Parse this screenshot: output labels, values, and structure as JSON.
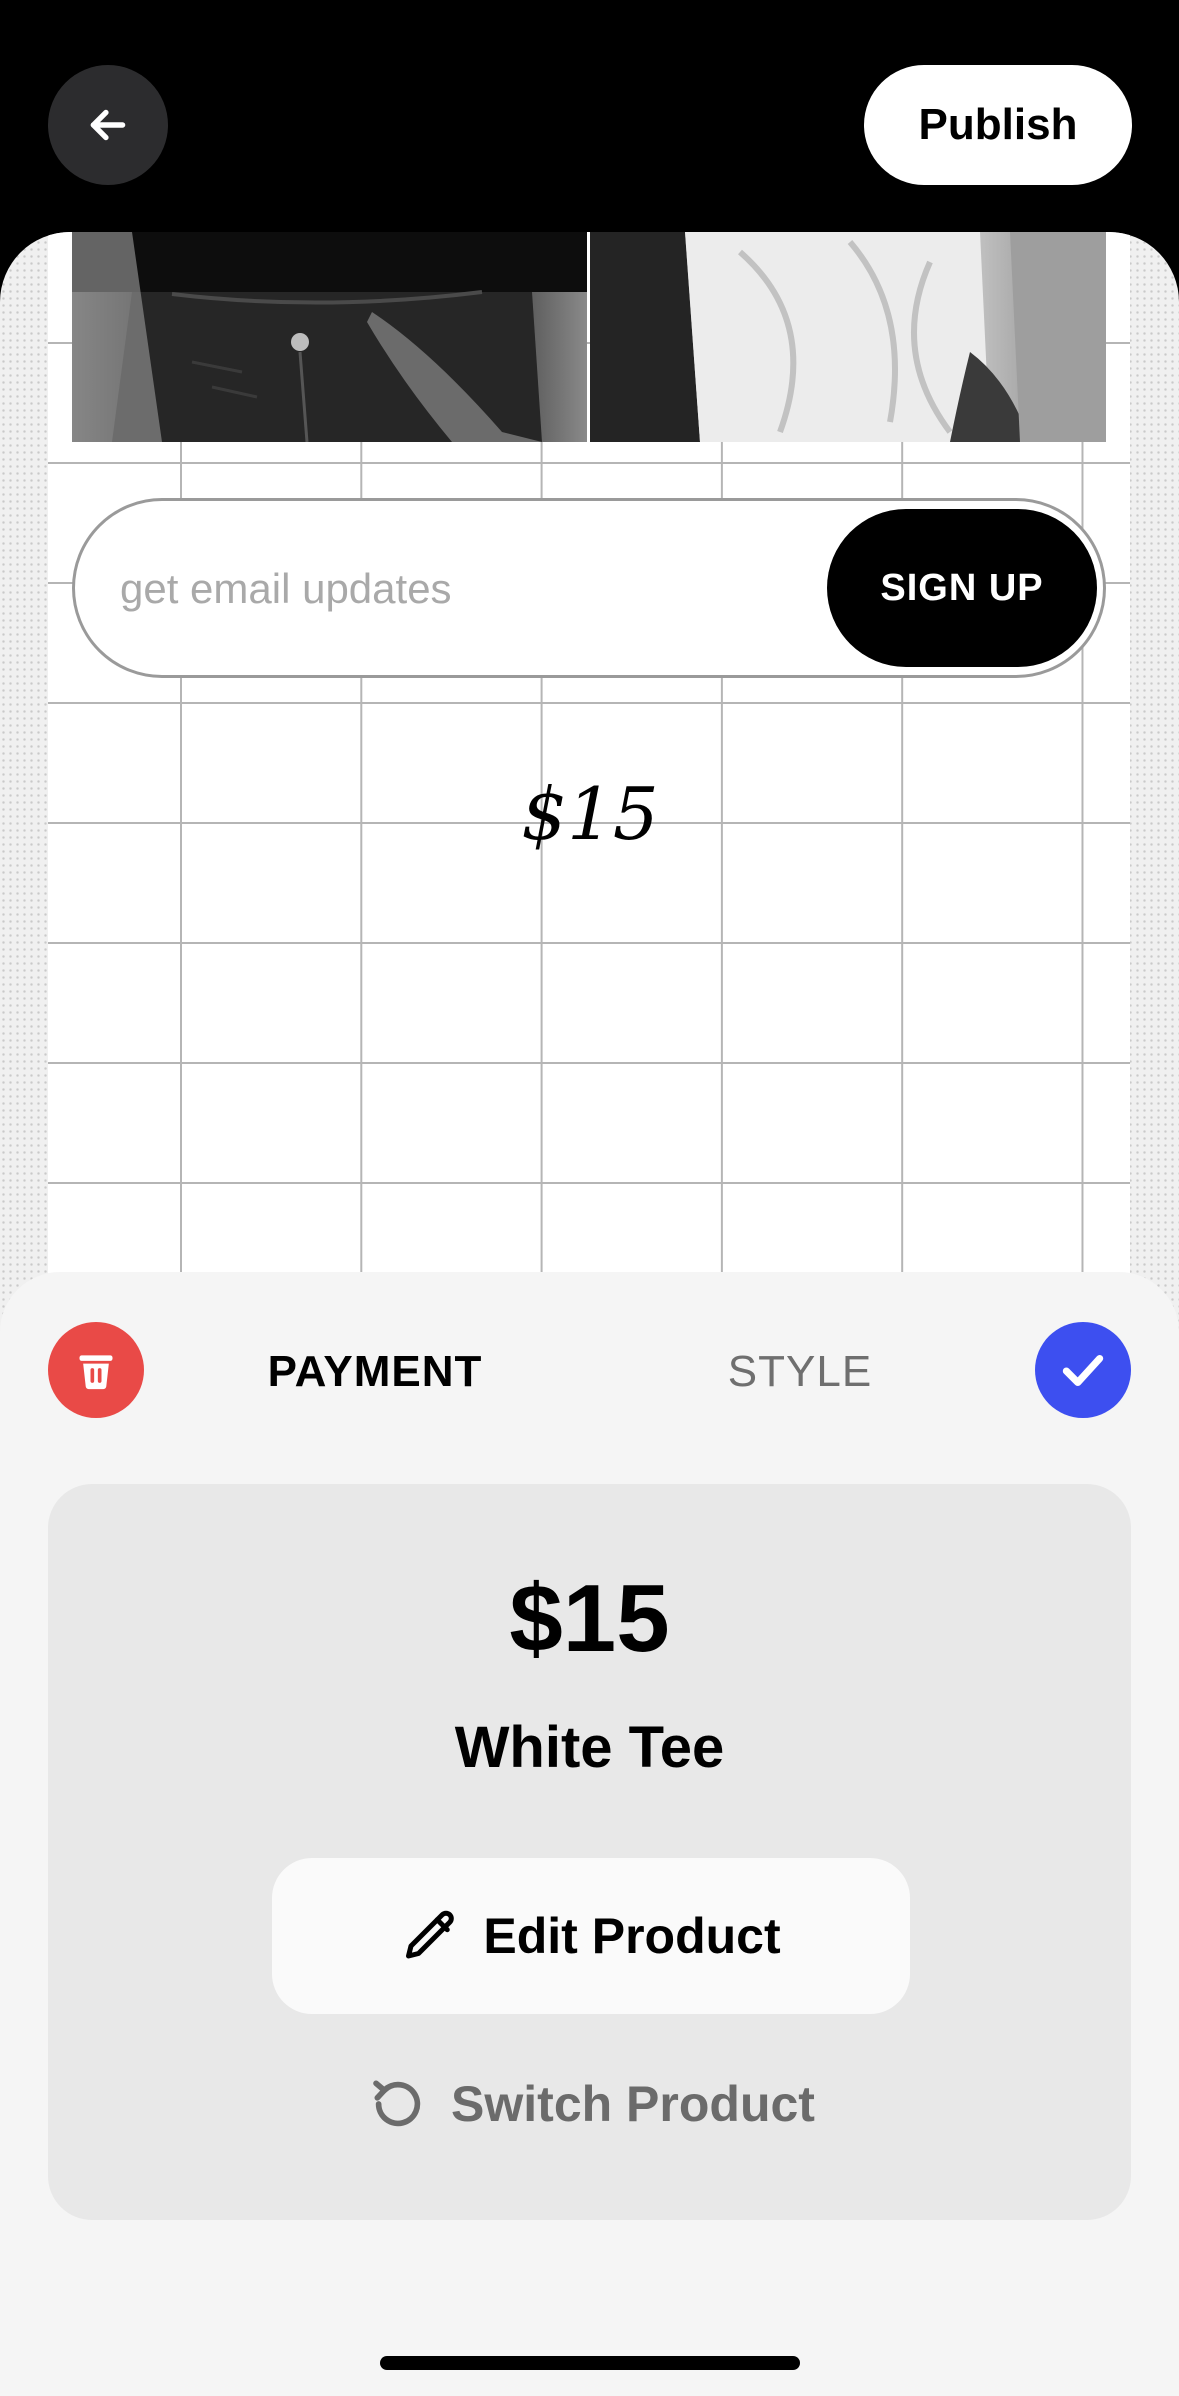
{
  "header": {
    "back_icon": "arrow-left-icon",
    "publish_label": "Publish"
  },
  "canvas": {
    "email_placeholder": "get email updates",
    "signup_label": "SIGN UP",
    "price_text": "$15"
  },
  "sheet": {
    "delete_icon": "trash-icon",
    "confirm_icon": "checkmark-icon",
    "tabs": [
      {
        "label": "PAYMENT",
        "active": true
      },
      {
        "label": "STYLE",
        "active": false
      }
    ],
    "product": {
      "price": "$15",
      "name": "White Tee"
    },
    "edit_label": "Edit Product",
    "edit_icon": "pencil-icon",
    "switch_label": "Switch Product",
    "switch_icon": "refresh-icon"
  },
  "colors": {
    "accent_blue": "#3d4ff0",
    "delete_red": "#e94a47",
    "top_bar": "#000000",
    "sheet_bg": "#f5f5f5",
    "card_bg": "#e8e8e8"
  }
}
